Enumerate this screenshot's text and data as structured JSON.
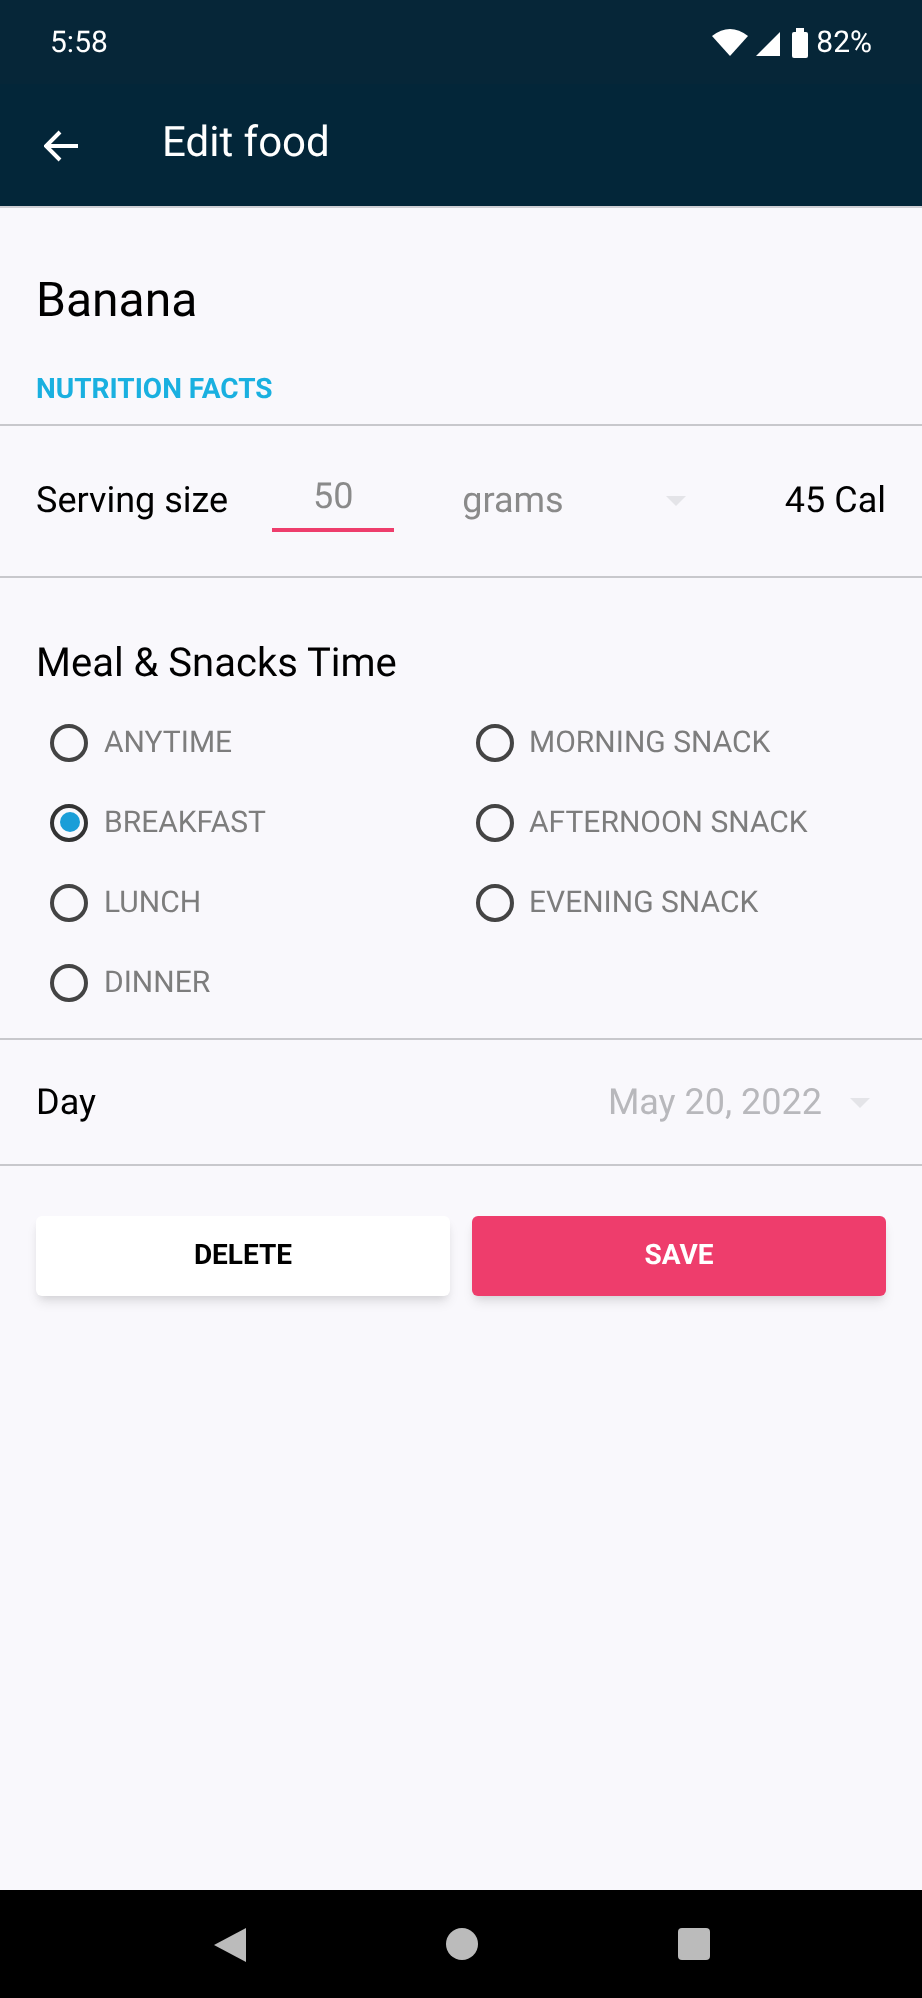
{
  "status_bar": {
    "time": "5:58",
    "battery": "82%"
  },
  "app_bar": {
    "title": "Edit food"
  },
  "food": {
    "name": "Banana",
    "section": "NUTRITION FACTS"
  },
  "serving": {
    "label": "Serving size",
    "value": "50",
    "unit": "grams",
    "calories": "45 Cal"
  },
  "meal": {
    "title": "Meal & Snacks Time",
    "columns": [
      [
        {
          "label": "ANYTIME",
          "selected": false
        },
        {
          "label": "BREAKFAST",
          "selected": true
        },
        {
          "label": "LUNCH",
          "selected": false
        },
        {
          "label": "DINNER",
          "selected": false
        }
      ],
      [
        {
          "label": "MORNING SNACK",
          "selected": false
        },
        {
          "label": "AFTERNOON SNACK",
          "selected": false
        },
        {
          "label": "EVENING SNACK",
          "selected": false
        }
      ]
    ]
  },
  "day": {
    "label": "Day",
    "value": "May 20, 2022"
  },
  "buttons": [
    {
      "label": "DELETE",
      "kind": "secondary"
    },
    {
      "label": "SAVE",
      "kind": "primary"
    }
  ]
}
